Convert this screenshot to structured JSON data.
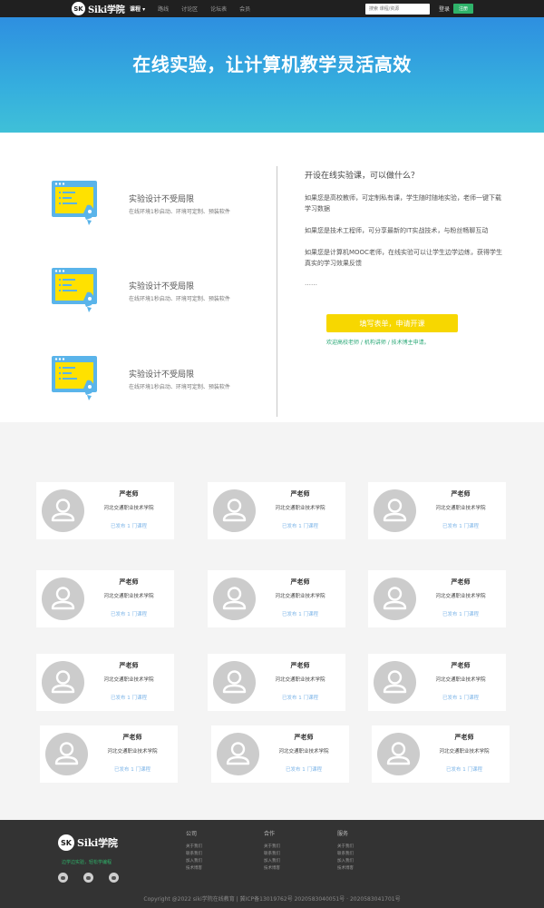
{
  "nav": {
    "logo_mark": "SK",
    "logo_text": "Siki学院",
    "links": [
      "课程 ▾",
      "路线",
      "讨论区",
      "论坛表",
      "会员"
    ],
    "search_placeholder": "搜索 课程/资源",
    "login_label": "登录",
    "register_label": "注册"
  },
  "banner": {
    "title": "在线实验，让计算机教学灵活高效"
  },
  "features": {
    "items": [
      {
        "title": "实验设计不受局限",
        "desc": "在线环境1秒启动、环境可定制、预装软件"
      },
      {
        "title": "实验设计不受局限",
        "desc": "在线环境1秒启动、环境可定制、预装软件"
      },
      {
        "title": "实验设计不受局限",
        "desc": "在线环境1秒启动、环境可定制、预装软件"
      }
    ],
    "right": {
      "title": "开设在线实验课，可以做什么？",
      "paragraphs": [
        "如果您是高校教师，可定制私有课，学生随时随地实验，老师一键下载学习数据",
        "如果您是技术工程师，可分享最新的IT实战技术，与粉丝畅聊互动",
        "如果您是计算机MOOC老师，在线实验可以让学生边学边练，获得学生真实的学习效果反馈"
      ],
      "dots": "……",
      "apply_button": "填写表单，申请开课",
      "apply_sub": "欢迎高校老师 / 机构讲师 / 技术博主申请。"
    }
  },
  "teachers": [
    {
      "name": "严老师",
      "school": "河北交通职业技术学院",
      "published": "已发布 1 门课程"
    },
    {
      "name": "严老师",
      "school": "河北交通职业技术学院",
      "published": "已发布 1 门课程"
    },
    {
      "name": "严老师",
      "school": "河北交通职业技术学院",
      "published": "已发布 1 门课程"
    },
    {
      "name": "严老师",
      "school": "河北交通职业技术学院",
      "published": "已发布 1 门课程"
    },
    {
      "name": "严老师",
      "school": "河北交通职业技术学院",
      "published": "已发布 1 门课程"
    },
    {
      "name": "严老师",
      "school": "河北交通职业技术学院",
      "published": "已发布 1 门课程"
    },
    {
      "name": "严老师",
      "school": "河北交通职业技术学院",
      "published": "已发布 1 门课程"
    },
    {
      "name": "严老师",
      "school": "河北交通职业技术学院",
      "published": "已发布 1 门课程"
    },
    {
      "name": "严老师",
      "school": "河北交通职业技术学院",
      "published": "已发布 1 门课程"
    },
    {
      "name": "严老师",
      "school": "河北交通职业技术学院",
      "published": "已发布 1 门课程"
    },
    {
      "name": "严老师",
      "school": "河北交通职业技术学院",
      "published": "已发布 1 门课程"
    },
    {
      "name": "严老师",
      "school": "河北交通职业技术学院",
      "published": "已发布 1 门课程"
    }
  ],
  "footer": {
    "logo_mark": "SK",
    "logo_text": "Siki学院",
    "slogan": "边学边实验，轻松学编程",
    "columns": [
      {
        "heading": "公司",
        "items": [
          "关于我们",
          "联系我们",
          "加入我们",
          "技术博客"
        ]
      },
      {
        "heading": "合作",
        "items": [
          "关于我们",
          "联系我们",
          "加入我们",
          "技术博客"
        ]
      },
      {
        "heading": "服务",
        "items": [
          "关于我们",
          "联系我们",
          "加入我们",
          "技术博客"
        ]
      }
    ],
    "social_icons": [
      "weibo-icon",
      "qq-icon",
      "wechat-icon"
    ],
    "copyright": "Copyright @2022 siki学院在线教育 | 冀ICP备13019762号 2020583040051号 · 2020583041701号"
  },
  "colors": {
    "accent_green": "#2fb36a",
    "apply_yellow": "#f7d700",
    "banner_blue": "#2e8fe0",
    "link_blue": "#7fb6e8",
    "footer_bg": "#333333"
  }
}
